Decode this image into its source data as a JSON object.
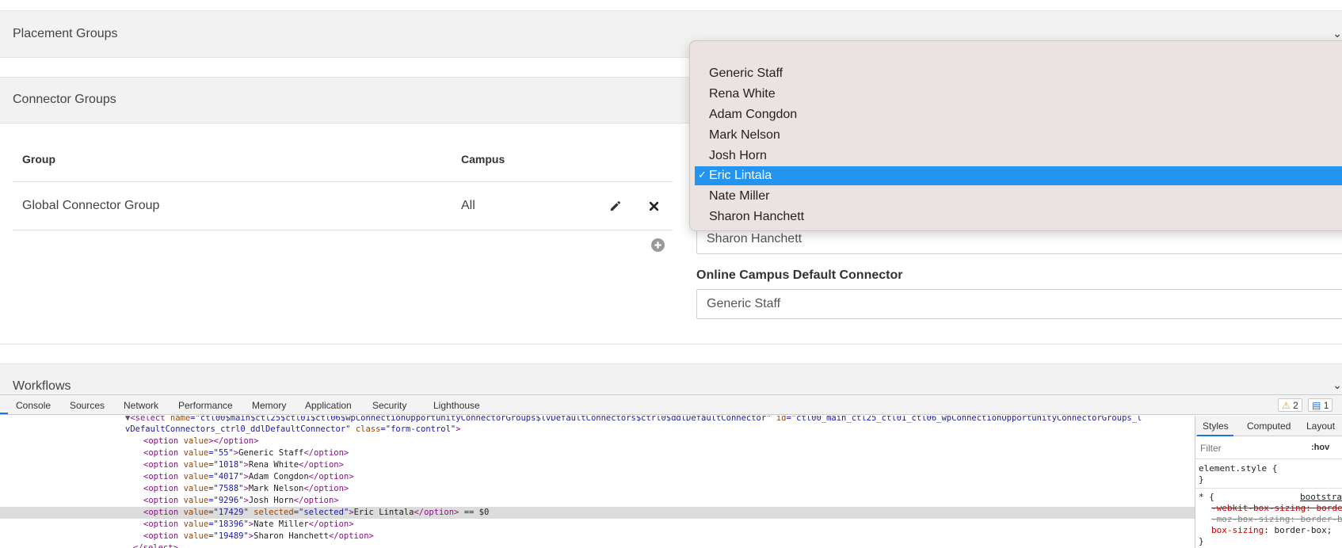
{
  "panels": {
    "placement_groups": "Placement Groups",
    "connector_groups": "Connector Groups",
    "workflows": "Workflows"
  },
  "table": {
    "headers": {
      "group": "Group",
      "campus": "Campus"
    },
    "row": {
      "group": "Global Connector Group",
      "campus": "All"
    }
  },
  "fields": {
    "first_value": "Sharon Hanchett",
    "online_label": "Online Campus Default Connector",
    "online_value": "Generic Staff"
  },
  "dropdown": {
    "options": [
      "Generic Staff",
      "Rena White",
      "Adam Congdon",
      "Mark Nelson",
      "Josh Horn",
      "Eric Lintala",
      "Nate Miller",
      "Sharon Hanchett"
    ],
    "selected": "Eric Lintala",
    "check": "✓"
  },
  "devtools": {
    "tabs": [
      "Console",
      "Sources",
      "Network",
      "Performance",
      "Memory",
      "Application",
      "Security",
      "Lighthouse"
    ],
    "warnings": "2",
    "messages": "1",
    "select_line1": "\"ctl00$main$ctl25$ctl01$ctl06$wpConnectionOpportunityConnectorGroups$lvDefaultConnectors$ctrl0$ddlDefaultConnector\"",
    "select_id1": "\"ctl00_main_ctl25_ctl01_ctl06_wpConnectionOpportunityConnectorGroups_l",
    "select_line2": "vDefaultConnectors_ctrl0_ddlDefaultConnector\"",
    "select_class": "\"form-control\"",
    "options": [
      {
        "value": "",
        "text": ""
      },
      {
        "value": "55",
        "text": "Generic Staff"
      },
      {
        "value": "1018",
        "text": "Rena White"
      },
      {
        "value": "4017",
        "text": "Adam Congdon"
      },
      {
        "value": "7588",
        "text": "Mark Nelson"
      },
      {
        "value": "9296",
        "text": "Josh Horn"
      },
      {
        "value": "17429",
        "text": "Eric Lintala"
      },
      {
        "value": "18396",
        "text": "Nate Miller"
      },
      {
        "value": "19489",
        "text": "Sharon Hanchett"
      }
    ],
    "selected_suffix": "== $0",
    "styles_tabs": [
      "Styles",
      "Computed",
      "Layout"
    ],
    "filter_placeholder": "Filter",
    "hov": ":hov",
    "element_style": "element.style {",
    "close_brace": "}",
    "rule_selector": "* {",
    "rule_source": "bootstrap.",
    "decl1": "-webkit-box-sizing: borde",
    "decl2": "-moz-box-sizing: border-b",
    "decl3_prop": "box-sizing",
    "decl3_val": ": border-box;"
  }
}
